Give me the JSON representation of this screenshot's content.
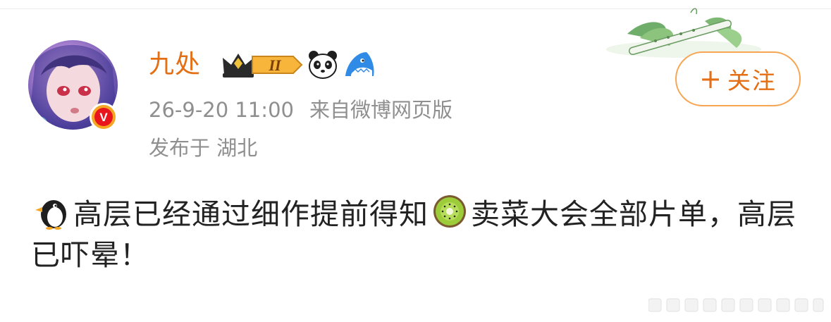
{
  "user": {
    "name": "九处",
    "verified_icon": "verified-v-icon",
    "verified_letter": "V",
    "badges": [
      "crown-level-badge",
      "panda-icon",
      "shark-icon"
    ],
    "level": "II"
  },
  "meta": {
    "time": "26-9-20 11:00",
    "source": "来自微博网页版",
    "location": "发布于 湖北"
  },
  "follow": {
    "plus": "+",
    "label": "关注"
  },
  "post": {
    "emoji_start": "penguin-emoji",
    "text_part1": "高层已经通过细作提前得知",
    "emoji_middle": "kiwi-emoji",
    "text_part2": "卖菜大会全部片单，高层已吓晕！"
  },
  "colors": {
    "accent": "#e46f14",
    "meta": "#8f8f8f",
    "text": "#222222",
    "follow_border": "#f7a552"
  }
}
